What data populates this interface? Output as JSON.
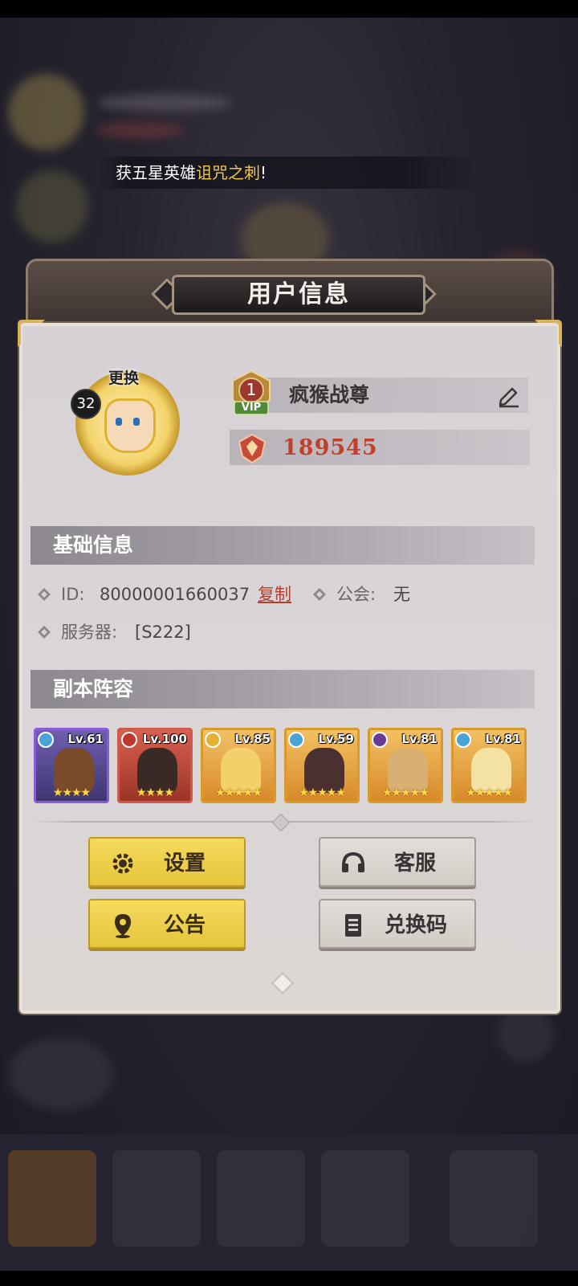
{
  "ticker": {
    "prefix": "获五星英雄",
    "hero": "诅咒之刺",
    "suffix": "!"
  },
  "panel": {
    "title": "用户信息"
  },
  "profile": {
    "avatar_change_label": "更换",
    "level": "32",
    "vip_level": "1",
    "vip_label": "VIP",
    "name": "疯猴战尊",
    "power": "189545"
  },
  "basic_info": {
    "section_title": "基础信息",
    "id_label": "ID:",
    "id_value": "80000001660037",
    "copy_label": "复制",
    "guild_label": "公会:",
    "guild_value": "无",
    "server_label": "服务器:",
    "server_value": "[S222]"
  },
  "lineup": {
    "section_title": "副本阵容",
    "heroes": [
      {
        "level": "Lv.61",
        "stars": "★★★★",
        "rarity": "purple"
      },
      {
        "level": "Lv.100",
        "stars": "★★★★",
        "rarity": "red"
      },
      {
        "level": "Lv.85",
        "stars": "★★★★★",
        "rarity": "gold"
      },
      {
        "level": "Lv.59",
        "stars": "★★★★★",
        "rarity": "gold"
      },
      {
        "level": "Lv.81",
        "stars": "★★★★★",
        "rarity": "gold"
      },
      {
        "level": "Lv.81",
        "stars": "★★★★★",
        "rarity": "gold"
      }
    ]
  },
  "buttons": {
    "settings": "设置",
    "support": "客服",
    "notice": "公告",
    "redeem": "兑换码"
  },
  "colors": {
    "accent_yellow": "#f0d24c",
    "power_red": "#c0402c",
    "hero_name_gold": "#f2c84a"
  }
}
